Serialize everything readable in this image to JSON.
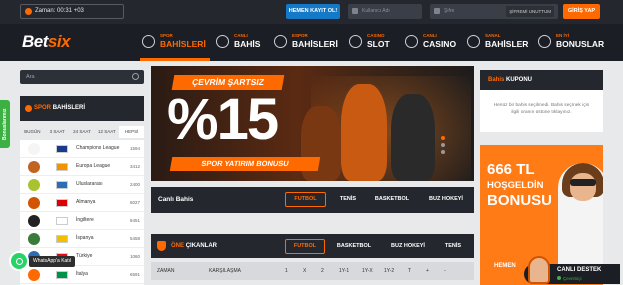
{
  "topbar": {
    "clock": "Zaman: 00:31 +03",
    "register": "HEMEN KAYIT OL!",
    "username_placeholder": "Kullanıcı Adı",
    "password_placeholder": "Şifre",
    "forgot": "ŞİFREMİ UNUTTUM",
    "login": "GİRİŞ YAP"
  },
  "brand": {
    "logo_a": "Bet",
    "logo_b": "six"
  },
  "nav": [
    {
      "small": "SPOR",
      "big": "BAHİSLERİ",
      "active": true
    },
    {
      "small": "CANLI",
      "big": "BAHİS"
    },
    {
      "small": "ESPOR",
      "big": "BAHİSLERİ"
    },
    {
      "small": "CASINO",
      "big": "SLOT"
    },
    {
      "small": "CANLI",
      "big": "CASINO"
    },
    {
      "small": "SANAL",
      "big": "BAHİSLER"
    },
    {
      "small": "EN İYİ",
      "big": "BONUSLAR"
    }
  ],
  "sidebar": {
    "bonus_tab": "Bonuslarımız",
    "search_placeholder": "Ara",
    "title_a": "SPOR",
    "title_b": "BAHİSLERİ",
    "filters": [
      "BUGÜN",
      "3 SAAT",
      "24 SAAT",
      "12 SAAT",
      "HEPSİ"
    ],
    "leagues": [
      {
        "name": "Champions League",
        "count": "1594",
        "sport": "#f5f5f5",
        "flag": "#1a3b8c"
      },
      {
        "name": "Europa League",
        "count": "3412",
        "sport": "#c0641f",
        "flag": "#f29400"
      },
      {
        "name": "Uluslararası",
        "count": "2400",
        "sport": "#a8c230",
        "flag": "#2d6db5"
      },
      {
        "name": "Almanya",
        "count": "6027",
        "sport": "#d35400",
        "flag": "#dd0000"
      },
      {
        "name": "İngiltere",
        "count": "8451",
        "sport": "#222222",
        "flag": "#ffffff"
      },
      {
        "name": "İspanya",
        "count": "5458",
        "sport": "#3a7a3a",
        "flag": "#f1bf00"
      },
      {
        "name": "Türkiye",
        "count": "1060",
        "sport": "#2d6db5",
        "flag": "#e30a17"
      },
      {
        "name": "İtalya",
        "count": "6591",
        "sport": "#ff6a00",
        "flag": "#009246"
      }
    ]
  },
  "hero": {
    "tag": "ÇEVRİM ŞARTSIZ",
    "big": "%15",
    "sub": "SPOR YATIRIM BONUSU"
  },
  "live": {
    "title": "Canlı Bahis",
    "tabs": [
      "FUTBOL",
      "TENİS",
      "BASKETBOL",
      "BUZ HOKEYİ"
    ]
  },
  "featured": {
    "title_a": "ÖNE",
    "title_b": "ÇIKANLAR",
    "tabs": [
      "FUTBOL",
      "BASKETBOL",
      "BUZ HOKEYİ",
      "TENİS"
    ],
    "columns": [
      "ZAMAN",
      "KARŞILAŞMA",
      "1",
      "X",
      "2",
      "1Y-1",
      "1Y-X",
      "1Y-2",
      "T",
      "+",
      "-"
    ]
  },
  "slip": {
    "title_a": "Bahis",
    "title_b": "KUPONU",
    "message": "Henüz bir bahis seçilmedi. Bahis seçmek için ilgili oranın üstüne tıklayınız."
  },
  "promo": {
    "amount": "666 TL",
    "line1": "HOŞGELDİN",
    "line2": "BONUSU",
    "cta": "HEMEN"
  },
  "whatsapp": {
    "label": "WhatsApp'a Katıl"
  },
  "support": {
    "title": "CANLI DESTEK",
    "status": "Çevrimiçi"
  },
  "colors": {
    "accent": "#ff6a00",
    "dark": "#24272e",
    "whatsapp": "#25d366"
  }
}
